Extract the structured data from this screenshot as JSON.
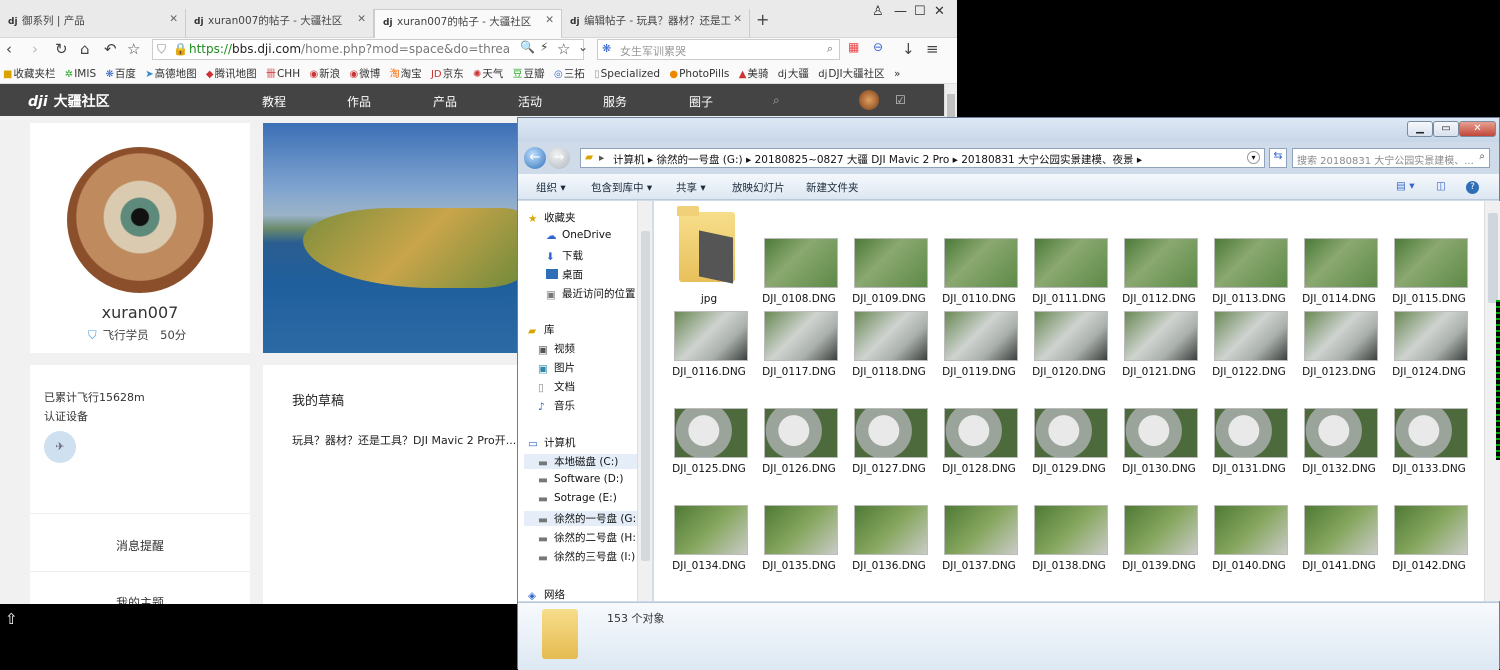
{
  "browser": {
    "tabs": [
      {
        "label": "御系列 | 产品",
        "icon": "dji-icon"
      },
      {
        "label": "xuran007的帖子 - 大疆社区",
        "icon": "dji-icon"
      },
      {
        "label": "xuran007的帖子 - 大疆社区",
        "icon": "dji-icon",
        "active": true
      },
      {
        "label": "编辑帖子 - 玩具？器材？还是工",
        "icon": "dji-icon"
      }
    ],
    "address": {
      "scheme": "https://",
      "host": "bbs.dji.com",
      "path": "/home.php?mod=space&do=threa"
    },
    "search_value": "女生军训累哭",
    "bookmarks": [
      "收藏夹栏",
      "IMIS",
      "百度",
      "高德地图",
      "腾讯地图",
      "CHH",
      "新浪",
      "微博",
      "淘宝",
      "京东",
      "天气",
      "豆瓣",
      "三拓",
      "Specialized",
      "PhotoPills",
      "美骑",
      "大疆",
      "DJI大疆社区",
      "»"
    ]
  },
  "dji": {
    "logo": "大疆社区",
    "nav": [
      "教程",
      "作品",
      "产品",
      "活动",
      "服务",
      "圈子"
    ],
    "username": "xuran007",
    "level": "飞行学员",
    "points": "50分",
    "flight": "已累计飞行15628m",
    "devices": "认证设备",
    "drafts_title": "我的草稿",
    "draft_item": "玩具？器材？还是工具？DJI Mavic 2 Pro开...",
    "links": [
      "消息提醒",
      "我的主题"
    ]
  },
  "explorer": {
    "breadcrumb": [
      "计算机",
      "徐然的一号盘 (G:)",
      "20180825~0827 大疆 DJI Mavic 2 Pro",
      "20180831 大宁公园实景建模、夜景"
    ],
    "search_placeholder": "搜索 20180831 大宁公园实景建模、...",
    "toolbar": [
      "组织 ▾",
      "包含到库中 ▾",
      "共享 ▾",
      "放映幻灯片",
      "新建文件夹"
    ],
    "nav": {
      "favorites": "收藏夹",
      "onedrive": "OneDrive",
      "downloads": "下载",
      "desktop": "桌面",
      "recent": "最近访问的位置",
      "libraries": "库",
      "videos": "视频",
      "pictures": "图片",
      "documents": "文档",
      "music": "音乐",
      "computer": "计算机",
      "c": "本地磁盘 (C:)",
      "d": "Software (D:)",
      "e": "Sotrage (E:)",
      "g": "徐然的一号盘 (G:)",
      "h": "徐然的二号盘 (H:)",
      "i": "徐然的三号盘 (I:)",
      "network": "网络"
    },
    "folder": "jpg",
    "files": [
      "DJI_0108.DNG",
      "DJI_0109.DNG",
      "DJI_0110.DNG",
      "DJI_0111.DNG",
      "DJI_0112.DNG",
      "DJI_0113.DNG",
      "DJI_0114.DNG",
      "DJI_0115.DNG",
      "DJI_0116.DNG",
      "DJI_0117.DNG",
      "DJI_0118.DNG",
      "DJI_0119.DNG",
      "DJI_0120.DNG",
      "DJI_0121.DNG",
      "DJI_0122.DNG",
      "DJI_0123.DNG",
      "DJI_0124.DNG",
      "DJI_0125.DNG",
      "DJI_0126.DNG",
      "DJI_0127.DNG",
      "DJI_0128.DNG",
      "DJI_0129.DNG",
      "DJI_0130.DNG",
      "DJI_0131.DNG",
      "DJI_0132.DNG",
      "DJI_0133.DNG",
      "DJI_0134.DNG",
      "DJI_0135.DNG",
      "DJI_0136.DNG",
      "DJI_0137.DNG",
      "DJI_0138.DNG",
      "DJI_0139.DNG",
      "DJI_0140.DNG",
      "DJI_0141.DNG",
      "DJI_0142.DNG"
    ],
    "status": "153 个对象"
  }
}
